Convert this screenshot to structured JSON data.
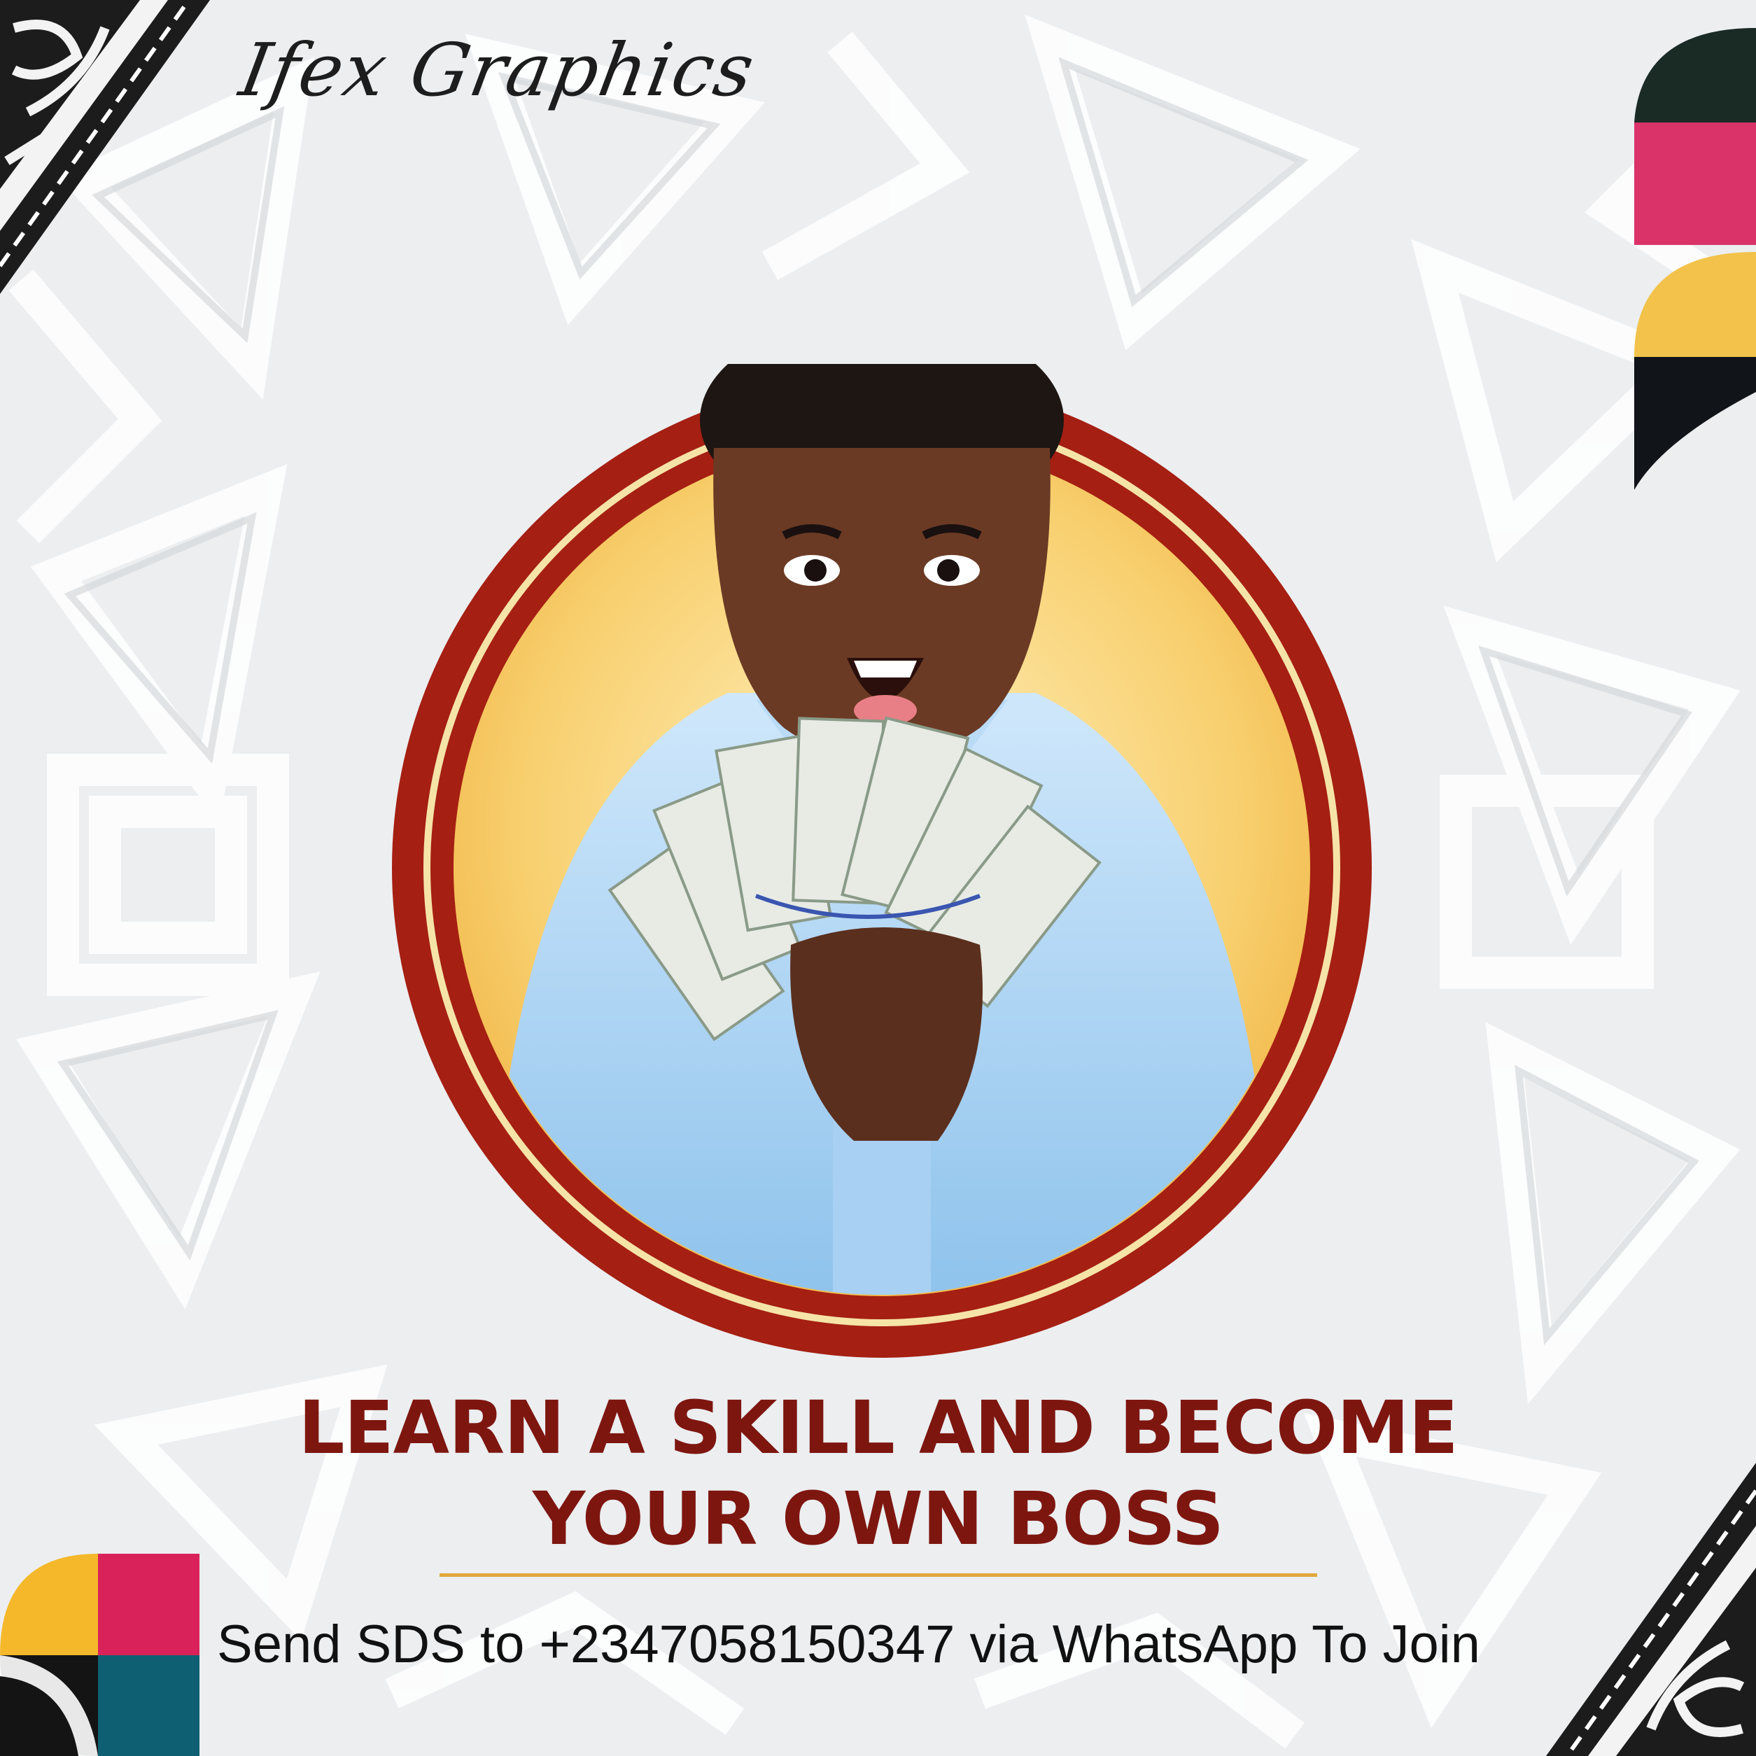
{
  "brand": {
    "name": "Ifex Graphics"
  },
  "headline": {
    "line1": "LEARN A SKILL AND BECOME",
    "line2": "YOUR OWN BOSS"
  },
  "cta": {
    "text": "Send SDS to +2347058150347 via WhatsApp To Join"
  },
  "colors": {
    "headline": "#7e1610",
    "ring": "#a51f12",
    "divider": "#e0a83a",
    "accent_pink": "#e0245e",
    "accent_yellow": "#f5c543",
    "accent_teal": "#0f5f73"
  }
}
